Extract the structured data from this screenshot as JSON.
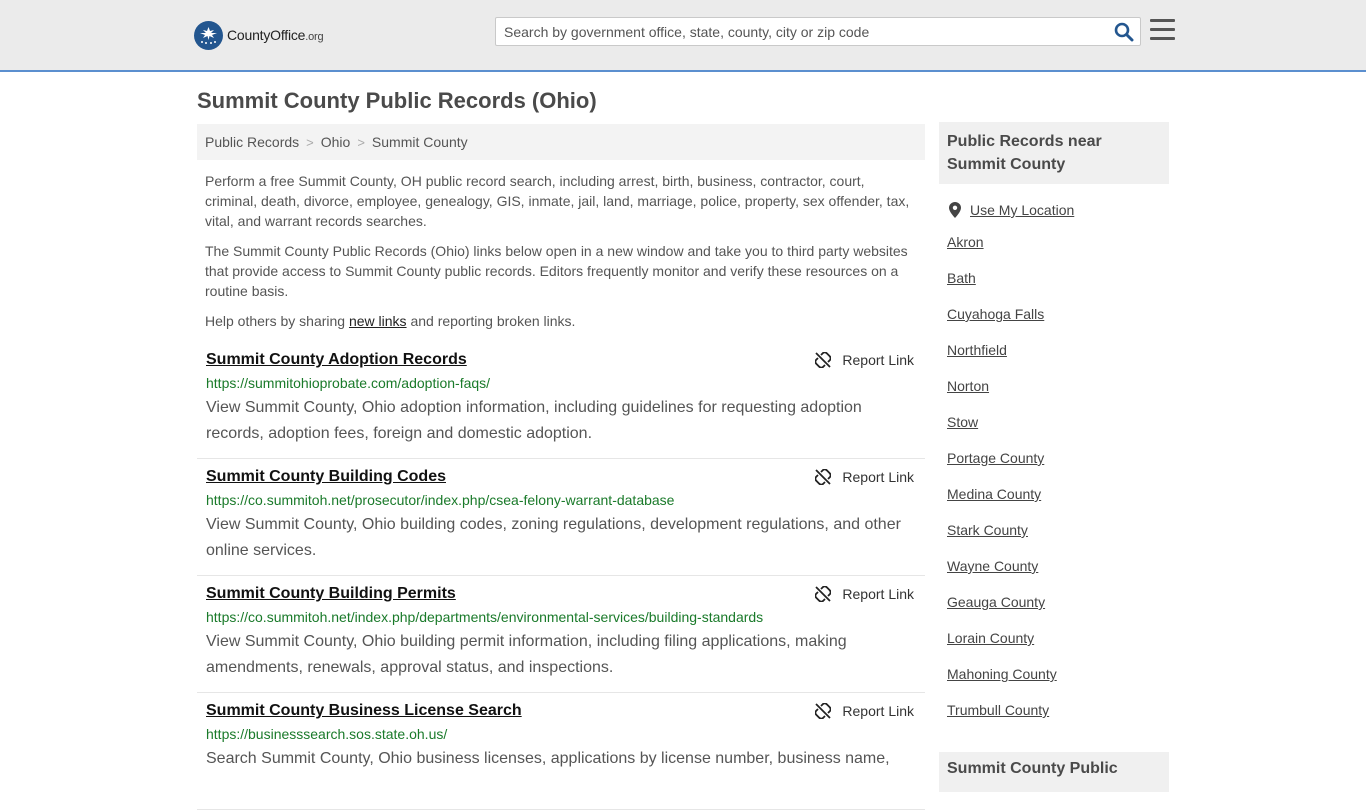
{
  "header": {
    "logo_main": "CountyOffice",
    "logo_suffix": ".org",
    "search_placeholder": "Search by government office, state, county, city or zip code"
  },
  "page": {
    "title": "Summit County Public Records (Ohio)"
  },
  "breadcrumb": [
    "Public Records",
    "Ohio",
    "Summit County"
  ],
  "intro": {
    "p1": "Perform a free Summit County, OH public record search, including arrest, birth, business, contractor, court, criminal, death, divorce, employee, genealogy, GIS, inmate, jail, land, marriage, police, property, sex offender, tax, vital, and warrant records searches.",
    "p2": "The Summit County Public Records (Ohio) links below open in a new window and take you to third party websites that provide access to Summit County public records. Editors frequently monitor and verify these resources on a routine basis.",
    "p3_before": "Help others by sharing ",
    "p3_link": "new links",
    "p3_after": " and reporting broken links."
  },
  "report_label": "Report Link",
  "listings": [
    {
      "title": "Summit County Adoption Records",
      "url": "https://summitohioprobate.com/adoption-faqs/",
      "desc": "View Summit County, Ohio adoption information, including guidelines for requesting adoption records, adoption fees, foreign and domestic adoption."
    },
    {
      "title": "Summit County Building Codes",
      "url": "https://co.summitoh.net/prosecutor/index.php/csea-felony-warrant-database",
      "desc": "View Summit County, Ohio building codes, zoning regulations, development regulations, and other online services."
    },
    {
      "title": "Summit County Building Permits",
      "url": "https://co.summitoh.net/index.php/departments/environmental-services/building-standards",
      "desc": "View Summit County, Ohio building permit information, including filing applications, making amendments, renewals, approval status, and inspections."
    },
    {
      "title": "Summit County Business License Search",
      "url": "https://businesssearch.sos.state.oh.us/",
      "desc": "Search Summit County, Ohio business licenses, applications by license number, business name,"
    }
  ],
  "sidebar": {
    "heading": "Public Records near Summit County",
    "use_location": "Use My Location",
    "places": [
      "Akron",
      "Bath",
      "Cuyahoga Falls",
      "Northfield",
      "Norton",
      "Stow",
      "Portage County",
      "Medina County",
      "Stark County",
      "Wayne County",
      "Geauga County",
      "Lorain County",
      "Mahoning County",
      "Trumbull County"
    ],
    "heading2": "Summit County Public"
  },
  "colors": {
    "header_bg": "#ebebeb",
    "accent_blue": "#23568f",
    "url_green": "#1a7a2a"
  }
}
